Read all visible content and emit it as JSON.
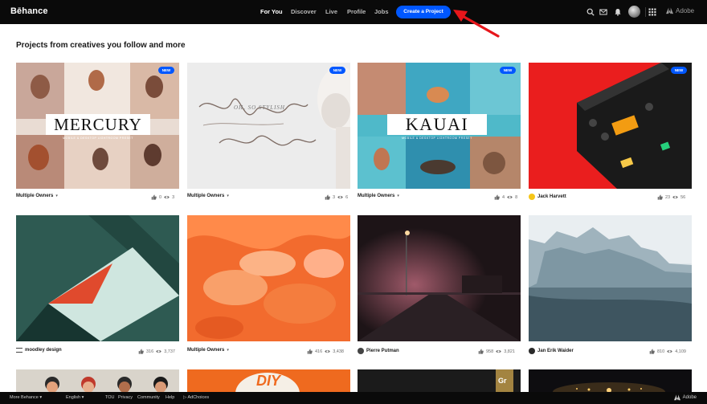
{
  "header": {
    "logo": "Bēhance",
    "nav": [
      "For You",
      "Discover",
      "Live",
      "Profile",
      "Jobs"
    ],
    "create_label": "Create a Project",
    "adobe_label": "Adobe"
  },
  "feed": {
    "heading": "Projects from creatives you follow and more",
    "new_badge": "NEW",
    "cards": [
      {
        "owner": "Multiple Owners",
        "likes": "0",
        "views": "3"
      },
      {
        "owner": "Multiple Owners",
        "likes": "3",
        "views": "6"
      },
      {
        "owner": "Multiple Owners",
        "likes": "4",
        "views": "8"
      },
      {
        "owner": "Jack Harvett",
        "likes": "23",
        "views": "56"
      },
      {
        "owner": "moodley design",
        "likes": "316",
        "views": "3,737"
      },
      {
        "owner": "Multiple Owners",
        "likes": "416",
        "views": "3,438"
      },
      {
        "owner": "Pierre Putman",
        "likes": "958",
        "views": "3,821"
      },
      {
        "owner": "Jan Erik Waider",
        "likes": "810",
        "views": "4,109"
      }
    ],
    "artwork_text": {
      "mercury": "MERCURY",
      "mercury_sub": "MOBILE & DESKTOP LIGHTROOM PRESET",
      "kauai": "KAUAI",
      "kauai_sub": "MOBILE & DESKTOP LIGHTROOM PRESET",
      "script_small": "OH, SO STYLISH",
      "gr": "Gr",
      "diy": "DIY"
    }
  },
  "footer": {
    "more": "More Behance",
    "language": "English",
    "links": [
      "TOU",
      "Privacy",
      "Community",
      "Help"
    ],
    "adchoices": "AdChoices",
    "adobe": "Adobe"
  },
  "colors": {
    "accent": "#0057ff",
    "topbar": "#0a0a0a",
    "annotation": "#e6161b"
  }
}
